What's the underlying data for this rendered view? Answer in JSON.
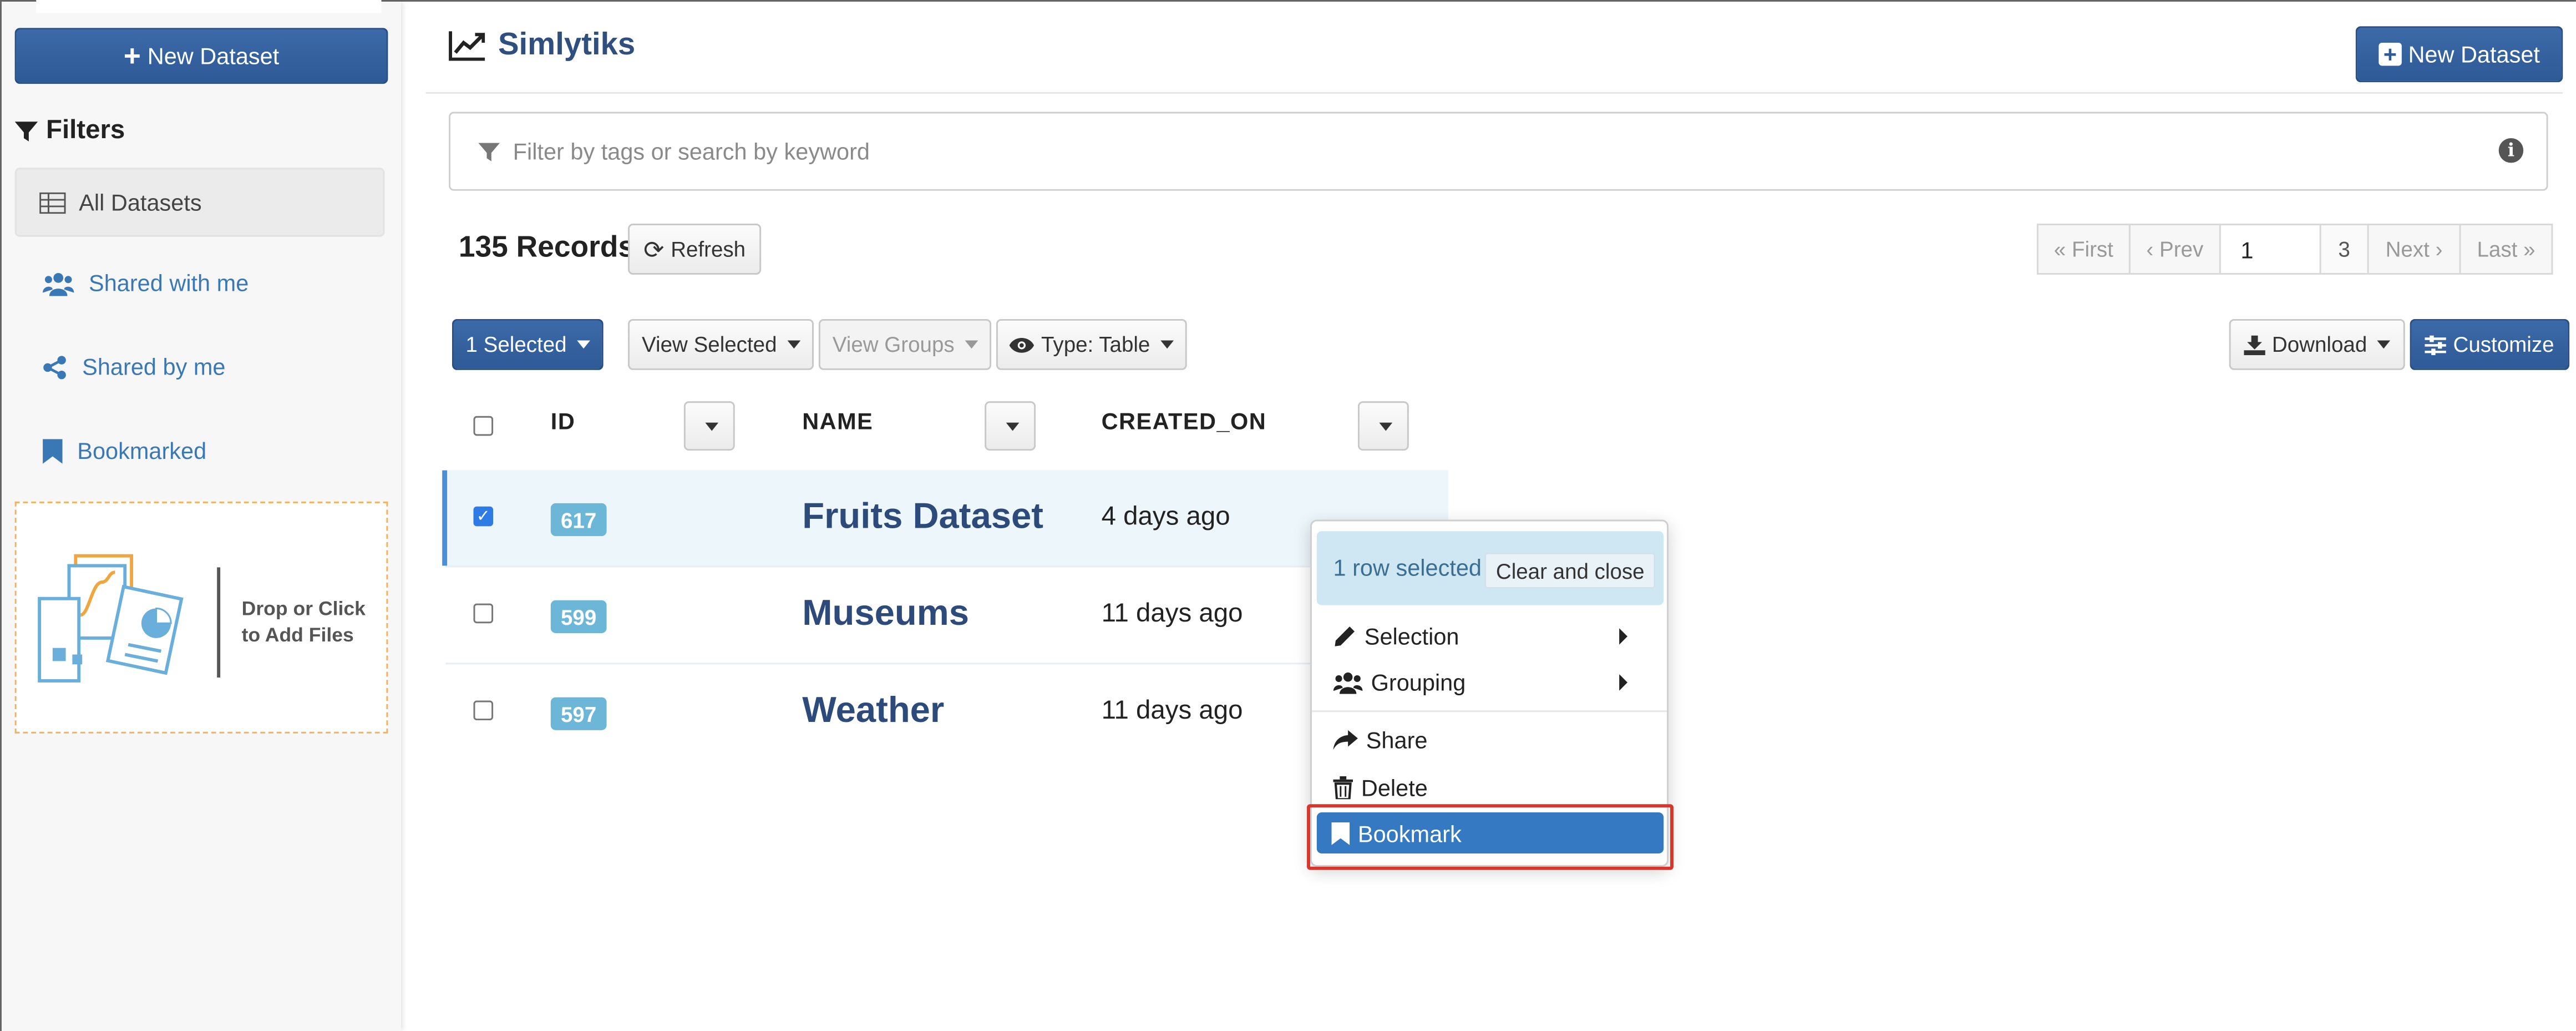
{
  "sidebar": {
    "new_dataset_label": "New Dataset",
    "filters_title": "Filters",
    "nav": [
      {
        "label": "All Datasets",
        "icon": "table-icon",
        "active": true
      },
      {
        "label": "Shared with me",
        "icon": "users-icon"
      },
      {
        "label": "Shared by me",
        "icon": "share-alt-icon"
      },
      {
        "label": "Bookmarked",
        "icon": "bookmark-icon"
      }
    ],
    "dropzone_text": [
      "Drop or Click",
      "to Add Files"
    ]
  },
  "header": {
    "brand": "Simlytiks",
    "new_dataset_label": "New Dataset"
  },
  "search": {
    "placeholder": "Filter by tags or search by keyword",
    "value": ""
  },
  "toolbar": {
    "records": "135 Records",
    "refresh_label": "Refresh",
    "selected_label": "1 Selected",
    "view_selected_label": "View Selected",
    "view_groups_label": "View Groups",
    "type_label": "Type: Table",
    "download_label": "Download",
    "customize_label": "Customize"
  },
  "pagination": {
    "first": "First",
    "prev": "Prev",
    "current": "1",
    "total": "3",
    "next": "Next",
    "last": "Last"
  },
  "table": {
    "columns": [
      "ID",
      "NAME",
      "CREATED_ON"
    ],
    "rows": [
      {
        "id": "617",
        "name": "Fruits Dataset",
        "created_on": "4 days ago",
        "selected": true
      },
      {
        "id": "599",
        "name": "Museums",
        "created_on": "11 days ago",
        "selected": false
      },
      {
        "id": "597",
        "name": "Weather",
        "created_on": "11 days ago",
        "selected": false
      }
    ]
  },
  "context_menu": {
    "selection_count": "1 row selected",
    "clear_label": "Clear and close",
    "items": {
      "selection": "Selection",
      "grouping": "Grouping",
      "share": "Share",
      "delete": "Delete",
      "bookmark": "Bookmark"
    }
  },
  "colors": {
    "primary": "#2e5a96",
    "brand_text": "#2c4a7a",
    "badge": "#6cb7d8",
    "highlight_border": "#d9362b"
  }
}
